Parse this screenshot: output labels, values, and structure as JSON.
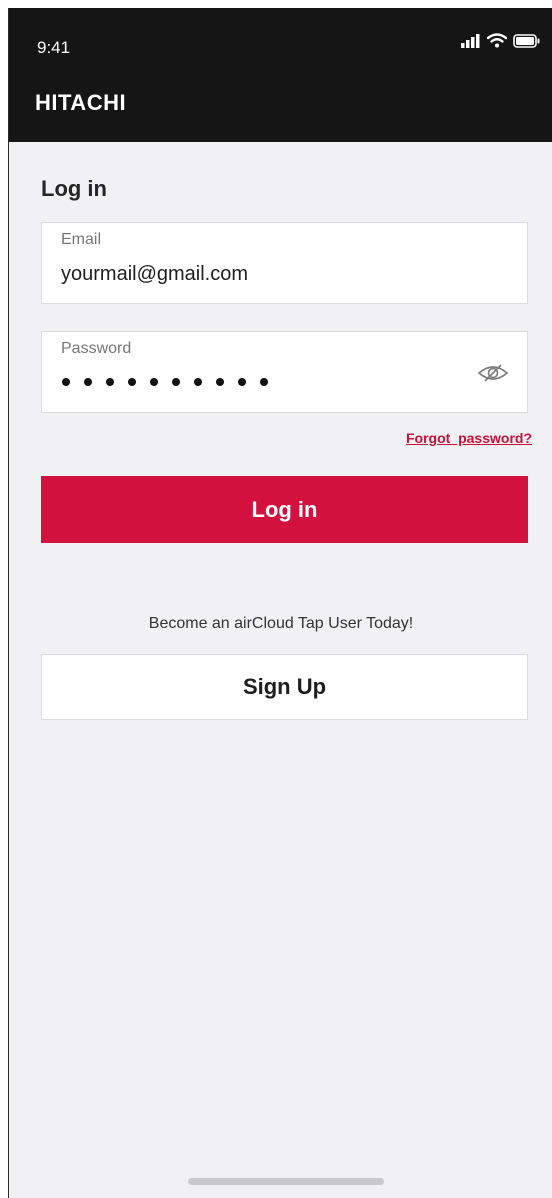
{
  "status_bar": {
    "time": "9:41",
    "icons": [
      "signal-icon",
      "wifi-icon",
      "battery-icon"
    ]
  },
  "header": {
    "brand": "HITACHI"
  },
  "form": {
    "title": "Log in",
    "email": {
      "label": "Email",
      "value": "yourmail@gmail.com"
    },
    "password": {
      "label": "Password",
      "masked_length": 10,
      "toggle_icon": "eye-slash-icon"
    },
    "forgot_link": "Forgot  password?",
    "submit_label": "Log in"
  },
  "signup": {
    "promo_text": "Become an airCloud Tap User Today!",
    "button_label": "Sign Up"
  },
  "colors": {
    "accent": "#d2113e",
    "header_bg": "#151515",
    "page_bg": "#f1f1f3"
  }
}
